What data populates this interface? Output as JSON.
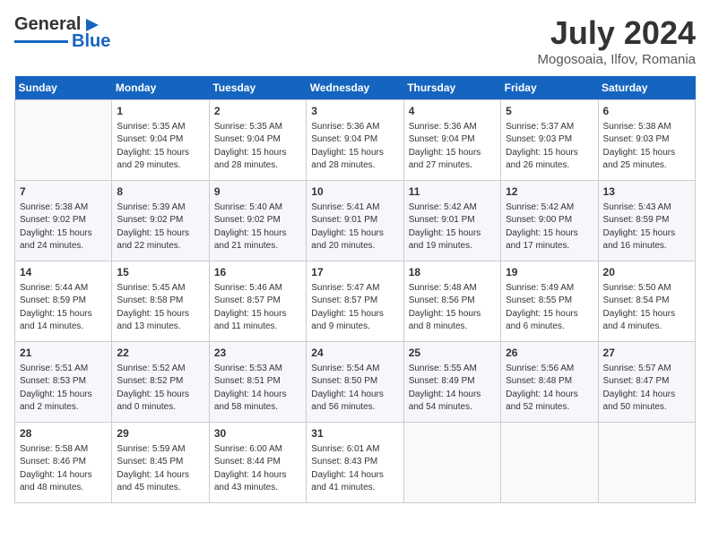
{
  "header": {
    "logo_general": "General",
    "logo_blue": "Blue",
    "month": "July 2024",
    "location": "Mogosoaia, Ilfov, Romania"
  },
  "days_of_week": [
    "Sunday",
    "Monday",
    "Tuesday",
    "Wednesday",
    "Thursday",
    "Friday",
    "Saturday"
  ],
  "weeks": [
    [
      {
        "day": "",
        "sunrise": "",
        "sunset": "",
        "daylight": ""
      },
      {
        "day": "1",
        "sunrise": "Sunrise: 5:35 AM",
        "sunset": "Sunset: 9:04 PM",
        "daylight": "Daylight: 15 hours and 29 minutes."
      },
      {
        "day": "2",
        "sunrise": "Sunrise: 5:35 AM",
        "sunset": "Sunset: 9:04 PM",
        "daylight": "Daylight: 15 hours and 28 minutes."
      },
      {
        "day": "3",
        "sunrise": "Sunrise: 5:36 AM",
        "sunset": "Sunset: 9:04 PM",
        "daylight": "Daylight: 15 hours and 28 minutes."
      },
      {
        "day": "4",
        "sunrise": "Sunrise: 5:36 AM",
        "sunset": "Sunset: 9:04 PM",
        "daylight": "Daylight: 15 hours and 27 minutes."
      },
      {
        "day": "5",
        "sunrise": "Sunrise: 5:37 AM",
        "sunset": "Sunset: 9:03 PM",
        "daylight": "Daylight: 15 hours and 26 minutes."
      },
      {
        "day": "6",
        "sunrise": "Sunrise: 5:38 AM",
        "sunset": "Sunset: 9:03 PM",
        "daylight": "Daylight: 15 hours and 25 minutes."
      }
    ],
    [
      {
        "day": "7",
        "sunrise": "Sunrise: 5:38 AM",
        "sunset": "Sunset: 9:02 PM",
        "daylight": "Daylight: 15 hours and 24 minutes."
      },
      {
        "day": "8",
        "sunrise": "Sunrise: 5:39 AM",
        "sunset": "Sunset: 9:02 PM",
        "daylight": "Daylight: 15 hours and 22 minutes."
      },
      {
        "day": "9",
        "sunrise": "Sunrise: 5:40 AM",
        "sunset": "Sunset: 9:02 PM",
        "daylight": "Daylight: 15 hours and 21 minutes."
      },
      {
        "day": "10",
        "sunrise": "Sunrise: 5:41 AM",
        "sunset": "Sunset: 9:01 PM",
        "daylight": "Daylight: 15 hours and 20 minutes."
      },
      {
        "day": "11",
        "sunrise": "Sunrise: 5:42 AM",
        "sunset": "Sunset: 9:01 PM",
        "daylight": "Daylight: 15 hours and 19 minutes."
      },
      {
        "day": "12",
        "sunrise": "Sunrise: 5:42 AM",
        "sunset": "Sunset: 9:00 PM",
        "daylight": "Daylight: 15 hours and 17 minutes."
      },
      {
        "day": "13",
        "sunrise": "Sunrise: 5:43 AM",
        "sunset": "Sunset: 8:59 PM",
        "daylight": "Daylight: 15 hours and 16 minutes."
      }
    ],
    [
      {
        "day": "14",
        "sunrise": "Sunrise: 5:44 AM",
        "sunset": "Sunset: 8:59 PM",
        "daylight": "Daylight: 15 hours and 14 minutes."
      },
      {
        "day": "15",
        "sunrise": "Sunrise: 5:45 AM",
        "sunset": "Sunset: 8:58 PM",
        "daylight": "Daylight: 15 hours and 13 minutes."
      },
      {
        "day": "16",
        "sunrise": "Sunrise: 5:46 AM",
        "sunset": "Sunset: 8:57 PM",
        "daylight": "Daylight: 15 hours and 11 minutes."
      },
      {
        "day": "17",
        "sunrise": "Sunrise: 5:47 AM",
        "sunset": "Sunset: 8:57 PM",
        "daylight": "Daylight: 15 hours and 9 minutes."
      },
      {
        "day": "18",
        "sunrise": "Sunrise: 5:48 AM",
        "sunset": "Sunset: 8:56 PM",
        "daylight": "Daylight: 15 hours and 8 minutes."
      },
      {
        "day": "19",
        "sunrise": "Sunrise: 5:49 AM",
        "sunset": "Sunset: 8:55 PM",
        "daylight": "Daylight: 15 hours and 6 minutes."
      },
      {
        "day": "20",
        "sunrise": "Sunrise: 5:50 AM",
        "sunset": "Sunset: 8:54 PM",
        "daylight": "Daylight: 15 hours and 4 minutes."
      }
    ],
    [
      {
        "day": "21",
        "sunrise": "Sunrise: 5:51 AM",
        "sunset": "Sunset: 8:53 PM",
        "daylight": "Daylight: 15 hours and 2 minutes."
      },
      {
        "day": "22",
        "sunrise": "Sunrise: 5:52 AM",
        "sunset": "Sunset: 8:52 PM",
        "daylight": "Daylight: 15 hours and 0 minutes."
      },
      {
        "day": "23",
        "sunrise": "Sunrise: 5:53 AM",
        "sunset": "Sunset: 8:51 PM",
        "daylight": "Daylight: 14 hours and 58 minutes."
      },
      {
        "day": "24",
        "sunrise": "Sunrise: 5:54 AM",
        "sunset": "Sunset: 8:50 PM",
        "daylight": "Daylight: 14 hours and 56 minutes."
      },
      {
        "day": "25",
        "sunrise": "Sunrise: 5:55 AM",
        "sunset": "Sunset: 8:49 PM",
        "daylight": "Daylight: 14 hours and 54 minutes."
      },
      {
        "day": "26",
        "sunrise": "Sunrise: 5:56 AM",
        "sunset": "Sunset: 8:48 PM",
        "daylight": "Daylight: 14 hours and 52 minutes."
      },
      {
        "day": "27",
        "sunrise": "Sunrise: 5:57 AM",
        "sunset": "Sunset: 8:47 PM",
        "daylight": "Daylight: 14 hours and 50 minutes."
      }
    ],
    [
      {
        "day": "28",
        "sunrise": "Sunrise: 5:58 AM",
        "sunset": "Sunset: 8:46 PM",
        "daylight": "Daylight: 14 hours and 48 minutes."
      },
      {
        "day": "29",
        "sunrise": "Sunrise: 5:59 AM",
        "sunset": "Sunset: 8:45 PM",
        "daylight": "Daylight: 14 hours and 45 minutes."
      },
      {
        "day": "30",
        "sunrise": "Sunrise: 6:00 AM",
        "sunset": "Sunset: 8:44 PM",
        "daylight": "Daylight: 14 hours and 43 minutes."
      },
      {
        "day": "31",
        "sunrise": "Sunrise: 6:01 AM",
        "sunset": "Sunset: 8:43 PM",
        "daylight": "Daylight: 14 hours and 41 minutes."
      },
      {
        "day": "",
        "sunrise": "",
        "sunset": "",
        "daylight": ""
      },
      {
        "day": "",
        "sunrise": "",
        "sunset": "",
        "daylight": ""
      },
      {
        "day": "",
        "sunrise": "",
        "sunset": "",
        "daylight": ""
      }
    ]
  ]
}
